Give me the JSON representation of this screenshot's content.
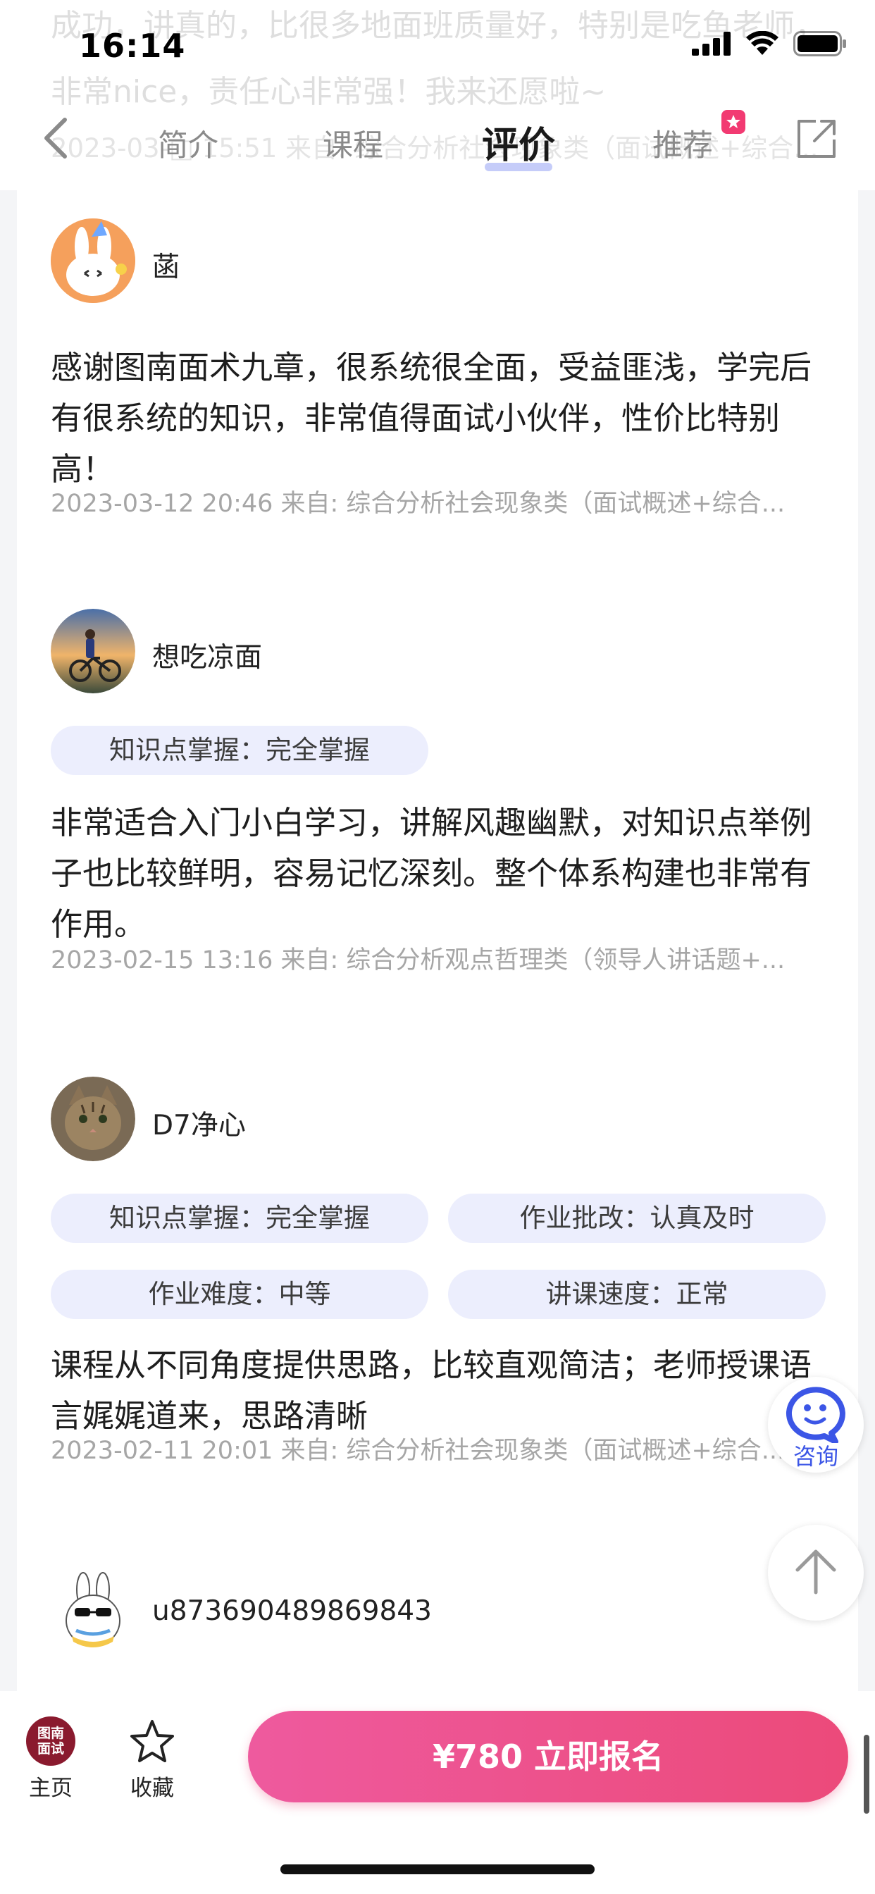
{
  "status_bar": {
    "time": "16:14"
  },
  "ghost_review": {
    "text": "成功，讲真的，比很多地面班质量好，特别是吃鱼老师，非常nice，责任心非常强！我来还愿啦~",
    "meta": "2023-03-□ 15:51  来自: 综合分析社会现象类（面试概述+综合..."
  },
  "nav": {
    "tabs": [
      "简介",
      "课程",
      "评价",
      "推荐"
    ],
    "active_tab": "评价",
    "accent_color": "#b7bff7",
    "badge_color": "#f23a72"
  },
  "reviews": [
    {
      "username": "菡",
      "avatar_icon": "bunny-avatar-icon",
      "tags": [],
      "text": "感谢图南面术九章，很系统很全面，受益匪浅，学完后有很系统的知识，非常值得面试小伙伴，性价比特别高！",
      "meta": "2023-03-12 20:46 来自: 综合分析社会现象类（面试概述+综合..."
    },
    {
      "username": "想吃凉面",
      "avatar_icon": "cyclist-avatar-icon",
      "tags": [
        "知识点掌握：完全掌握"
      ],
      "text": "非常适合入门小白学习，讲解风趣幽默，对知识点举例子也比较鲜明，容易记忆深刻。整个体系构建也非常有作用。",
      "meta": "2023-02-15 13:16  来自: 综合分析观点哲理类（领导人讲话题+..."
    },
    {
      "username": "D7净心",
      "avatar_icon": "cat-avatar-icon",
      "tags": [
        "知识点掌握：完全掌握",
        "作业批改：认真及时",
        "作业难度：中等",
        "讲课速度：正常"
      ],
      "text": "课程从不同角度提供思路，比较直观简洁；老师授课语言娓娓道来，思路清晰",
      "meta": "2023-02-11 20:01  来自: 综合分析社会现象类（面试概述+综合..."
    },
    {
      "username": "u873690489869843",
      "avatar_icon": "sunglasses-bunny-avatar-icon",
      "tags": [],
      "text": "",
      "meta": ""
    }
  ],
  "floating": {
    "consult_label": "咨询"
  },
  "bottom_bar": {
    "logo_text": "图南面试",
    "home_label": "主页",
    "favorite_label": "收藏",
    "cta_label": "¥780 立即报名",
    "cta_color": "#ec4a7a"
  }
}
